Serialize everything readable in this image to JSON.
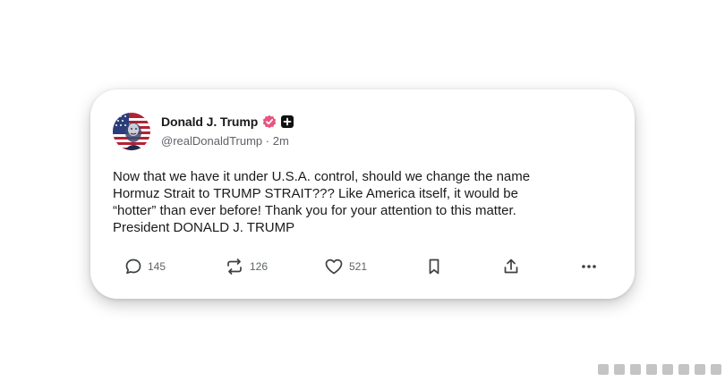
{
  "post": {
    "display_name": "Donald J. Trump",
    "handle": "@realDonaldTrump",
    "separator": "·",
    "time": "2m",
    "text": "Now that we have it under U.S.A. control, should we change the name\nHormuz Strait to TRUMP STRAIT??? Like America itself, it would be\n“hotter” than ever before! Thank you for your attention to this matter.\nPresident DONALD J. TRUMP"
  },
  "actions": {
    "replies": "145",
    "reposts": "126",
    "likes": "521"
  },
  "icons": {
    "verified": "verified-badge-icon",
    "plus": "plus-badge-icon",
    "reply": "speech-bubble-icon",
    "repost": "repost-arrows-icon",
    "like": "heart-icon",
    "bookmark": "bookmark-icon",
    "share": "share-upload-icon",
    "more": "more-dots-icon"
  },
  "colors": {
    "verified": "#e8547e",
    "text": "#1a1a1a",
    "muted": "#5f6368"
  }
}
